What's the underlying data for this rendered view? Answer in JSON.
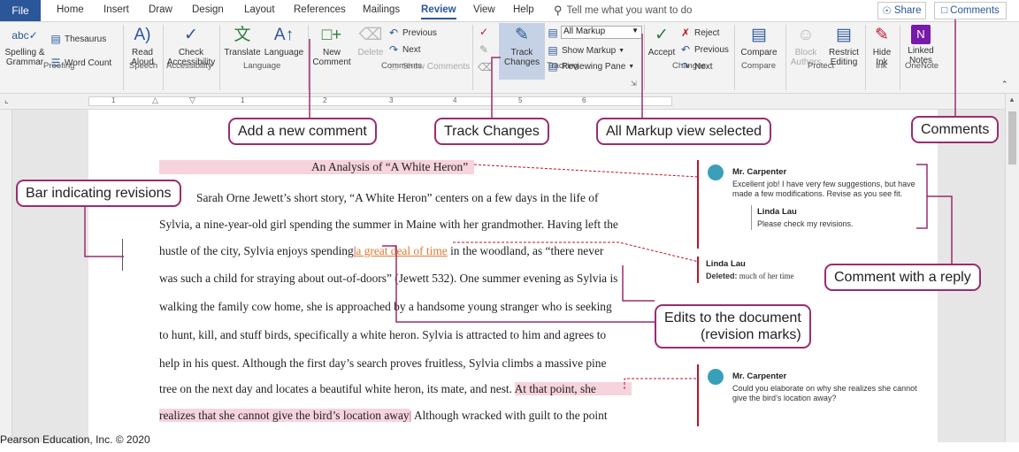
{
  "tabs": {
    "file": "File",
    "home": "Home",
    "insert": "Insert",
    "draw": "Draw",
    "design": "Design",
    "layout": "Layout",
    "references": "References",
    "mailings": "Mailings",
    "review": "Review",
    "view": "View",
    "help": "Help"
  },
  "tell_me": "Tell me what you want to do",
  "share": "Share",
  "comments_btn": "Comments",
  "ribbon": {
    "spelling": [
      "Spelling &",
      "Grammar"
    ],
    "thesaurus": "Thesaurus",
    "word_count": "Word Count",
    "read_aloud": [
      "Read",
      "Aloud"
    ],
    "check_accessibility": [
      "Check",
      "Accessibility"
    ],
    "translate": "Translate",
    "language": "Language",
    "new_comment": [
      "New",
      "Comment"
    ],
    "delete": "Delete",
    "previous": "Previous",
    "next": "Next",
    "show_comments": "Show Comments",
    "track_changes": [
      "Track",
      "Changes"
    ],
    "all_markup": "All Markup",
    "show_markup": "Show Markup",
    "reviewing_pane": "Reviewing Pane",
    "accept": "Accept",
    "reject": "Reject",
    "previous2": "Previous",
    "next2": "Next",
    "compare": "Compare",
    "block_authors": [
      "Block",
      "Authors"
    ],
    "restrict_editing": [
      "Restrict",
      "Editing"
    ],
    "hide_ink": [
      "Hide",
      "Ink"
    ],
    "linked_notes": [
      "Linked",
      "Notes"
    ]
  },
  "groups": {
    "proofing": "Proofing",
    "speech": "Speech",
    "accessibility": "Accessibility",
    "language": "Language",
    "comments": "Comments",
    "tracking": "Tracking",
    "changes": "Changes",
    "compare": "Compare",
    "protect": "Protect",
    "ink": "Ink",
    "onenote": "OneNote"
  },
  "ruler_numbers": [
    "1",
    "1",
    "2",
    "3",
    "4",
    "5",
    "6"
  ],
  "document": {
    "title": "An Analysis of “A White Heron”",
    "l1": "Sarah Orne Jewett’s short story, “A White Heron” centers on a few days in the life of",
    "l2": "Sylvia, a nine-year-old girl spending the summer in Maine with her grandmother. Having left the",
    "l3a": "hustle of the city, Sylvia enjoys spending",
    "l3ins": "a great deal of time",
    "l3b": " in the woodland, as “there never",
    "l4": "was such a child for straying about out-of-doors” (Jewett 532).  One summer evening as Sylvia is",
    "l5": "walking the family cow home, she is approached by a handsome young stranger who is seeking",
    "l6": "to hunt, kill, and stuff birds, specifically a white heron. Sylvia is attracted to him and agrees to",
    "l7": "help in his quest. Although the first day’s search proves fruitless, Sylvia climbs a massive pine",
    "l8a": "tree on the next day and locates a beautiful white heron, its mate, and nest. ",
    "l8hl": "At that point, she",
    "l9hl": "realizes that she cannot give the bird’s location away",
    "l9b": " Although wracked with guilt to the point"
  },
  "markup_pane": {
    "c1_author": "Mr. Carpenter",
    "c1_text1": "Excellent job! I have very few suggestions, but have",
    "c1_text2": "made a few modifications. Revise as you see fit.",
    "r1_author": "Linda Lau",
    "r1_text": "Please check my revisions.",
    "d_author": "Linda Lau",
    "d_label": "Deleted:",
    "d_text": " much of her time",
    "c2_author": "Mr. Carpenter",
    "c2_text1": "Could you elaborate on why she realizes she cannot",
    "c2_text2": "give the bird’s location away?"
  },
  "callouts": {
    "add_comment": "Add a new comment",
    "track_changes": "Track Changes",
    "all_markup": "All Markup view selected",
    "comments": "Comments",
    "bar_revisions": "Bar indicating revisions",
    "comment_reply": "Comment with a reply",
    "edits1": "Edits to the document",
    "edits2": "(revision marks)"
  },
  "footer": "Pearson Education, Inc. © 2020",
  "colors": {
    "accent": "#2b579a",
    "callout_border": "#9b2c6e",
    "revision_red": "#c0102a",
    "highlight": "#f6d3dd",
    "insertion": "#e07a2e"
  }
}
